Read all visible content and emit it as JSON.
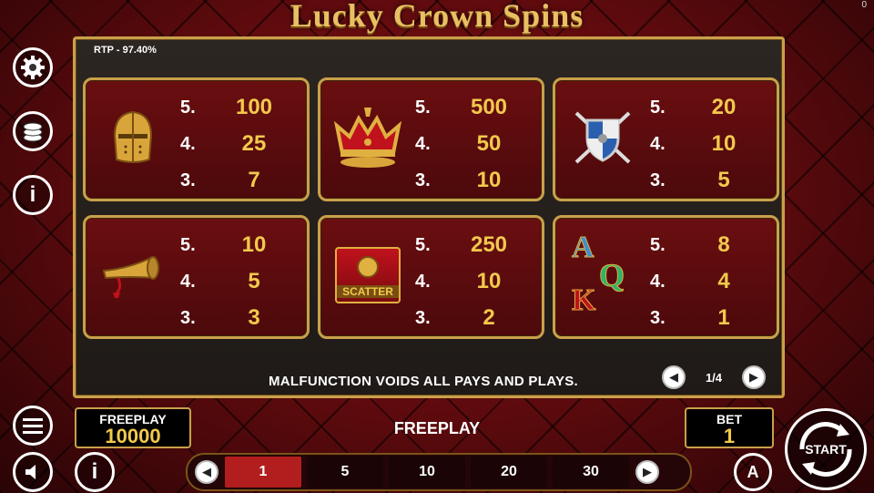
{
  "title": "Lucky Crown Spins",
  "corner_counter": "0",
  "rtp": "RTP - 97.40%",
  "paytable": [
    {
      "symbol": "knight-helmet",
      "pays": [
        {
          "n": "5.",
          "v": "100"
        },
        {
          "n": "4.",
          "v": "25"
        },
        {
          "n": "3.",
          "v": "7"
        }
      ]
    },
    {
      "symbol": "crown",
      "pays": [
        {
          "n": "5.",
          "v": "500"
        },
        {
          "n": "4.",
          "v": "50"
        },
        {
          "n": "3.",
          "v": "10"
        }
      ]
    },
    {
      "symbol": "shield-swords",
      "pays": [
        {
          "n": "5.",
          "v": "20"
        },
        {
          "n": "4.",
          "v": "10"
        },
        {
          "n": "3.",
          "v": "5"
        }
      ]
    },
    {
      "symbol": "horn",
      "pays": [
        {
          "n": "5.",
          "v": "10"
        },
        {
          "n": "4.",
          "v": "5"
        },
        {
          "n": "3.",
          "v": "3"
        }
      ]
    },
    {
      "symbol": "scatter",
      "label": "SCATTER",
      "pays": [
        {
          "n": "5.",
          "v": "250"
        },
        {
          "n": "4.",
          "v": "10"
        },
        {
          "n": "3.",
          "v": "2"
        }
      ]
    },
    {
      "symbol": "aqk",
      "letters": [
        "A",
        "Q",
        "K"
      ],
      "pays": [
        {
          "n": "5.",
          "v": "8"
        },
        {
          "n": "4.",
          "v": "4"
        },
        {
          "n": "3.",
          "v": "1"
        }
      ]
    }
  ],
  "notice": "MALFUNCTION VOIDS ALL PAYS AND PLAYS.",
  "pager": {
    "indicator": "1/4"
  },
  "freeplay_box": {
    "label": "FREEPLAY",
    "value": "10000"
  },
  "center_label": "FREEPLAY",
  "bet_box": {
    "label": "BET",
    "value": "1"
  },
  "bet_options": [
    "1",
    "5",
    "10",
    "20",
    "30"
  ],
  "selected_bet": "1",
  "start_label": "START",
  "auto_label": "A",
  "info_label": "i",
  "colors": {
    "gold": "#c9a04a",
    "value_gold": "#f2c94c",
    "card_red": "#6a0e10",
    "selected": "#b21e1e"
  }
}
